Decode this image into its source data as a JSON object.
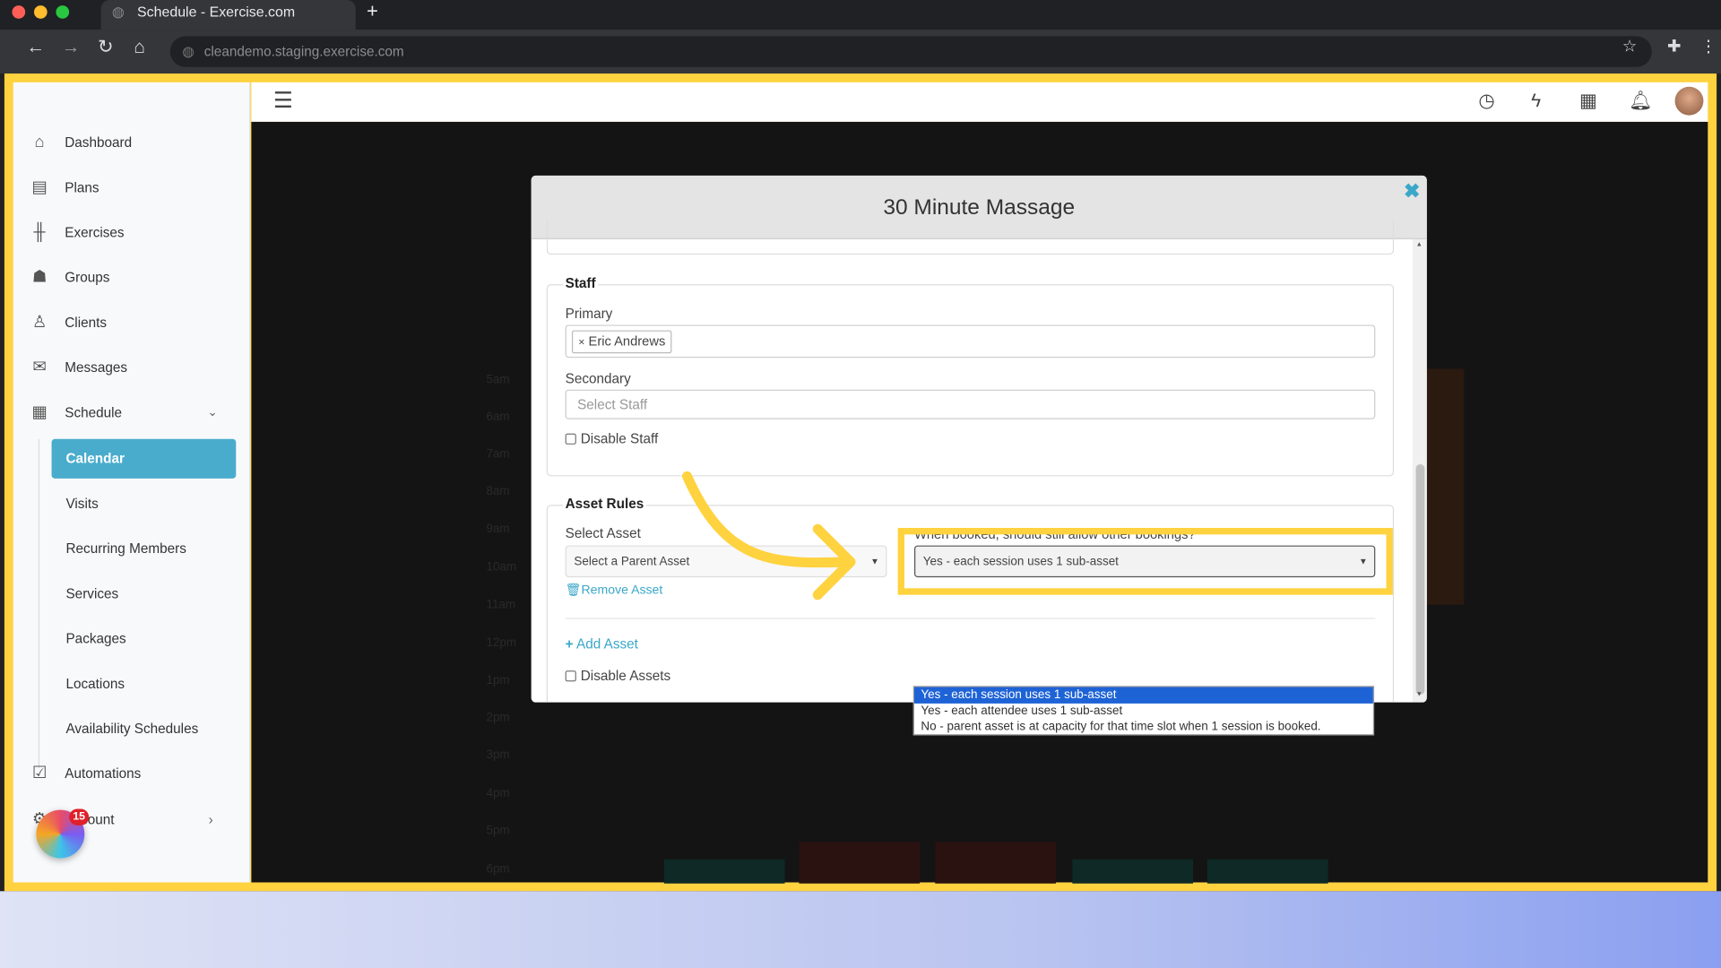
{
  "browser": {
    "tab_title": "Schedule - Exercise.com",
    "new_tab": "+",
    "url": "cleandemo.staging.exercise.com"
  },
  "sidebar": {
    "items": [
      {
        "label": "Dashboard",
        "icon": "home-icon"
      },
      {
        "label": "Plans",
        "icon": "clipboard-icon"
      },
      {
        "label": "Exercises",
        "icon": "dumbbell-icon"
      },
      {
        "label": "Groups",
        "icon": "users-icon"
      },
      {
        "label": "Clients",
        "icon": "user-icon"
      },
      {
        "label": "Messages",
        "icon": "envelope-icon"
      },
      {
        "label": "Schedule",
        "icon": "calendar-icon"
      }
    ],
    "schedule_sub": [
      "Calendar",
      "Visits",
      "Recurring Members",
      "Services",
      "Packages",
      "Locations",
      "Availability Schedules"
    ],
    "automations": "Automations",
    "account": "Account",
    "badge_count": "15",
    "accent": "#4aaccc"
  },
  "calendar_bg": {
    "times": [
      "5am",
      "6am",
      "7am",
      "8am",
      "9am",
      "10am",
      "11am",
      "12pm",
      "1pm",
      "2pm",
      "3pm",
      "4pm",
      "5pm",
      "6pm"
    ]
  },
  "modal": {
    "title": "30 Minute Massage",
    "close": "✖",
    "staff": {
      "legend": "Staff",
      "primary_label": "Primary",
      "primary_tag": "Eric Andrews",
      "tag_remove": "×",
      "secondary_label": "Secondary",
      "secondary_placeholder": "Select Staff",
      "disable_label": "Disable Staff"
    },
    "assets": {
      "legend": "Asset Rules",
      "select_label": "Select Asset",
      "select_value": "Select a Parent Asset",
      "booking_label": "When booked, should still allow other bookings?",
      "booking_value": "Yes - each session uses 1 sub-asset",
      "remove": "Remove Asset",
      "add": "Add Asset",
      "disable_label": "Disable Assets",
      "options": [
        "Yes - each session uses 1 sub-asset",
        "Yes - each attendee uses 1 sub-asset",
        "No - parent asset is at capacity for that time slot when 1 session is booked."
      ]
    }
  },
  "annotation_color": "#ffd23f"
}
